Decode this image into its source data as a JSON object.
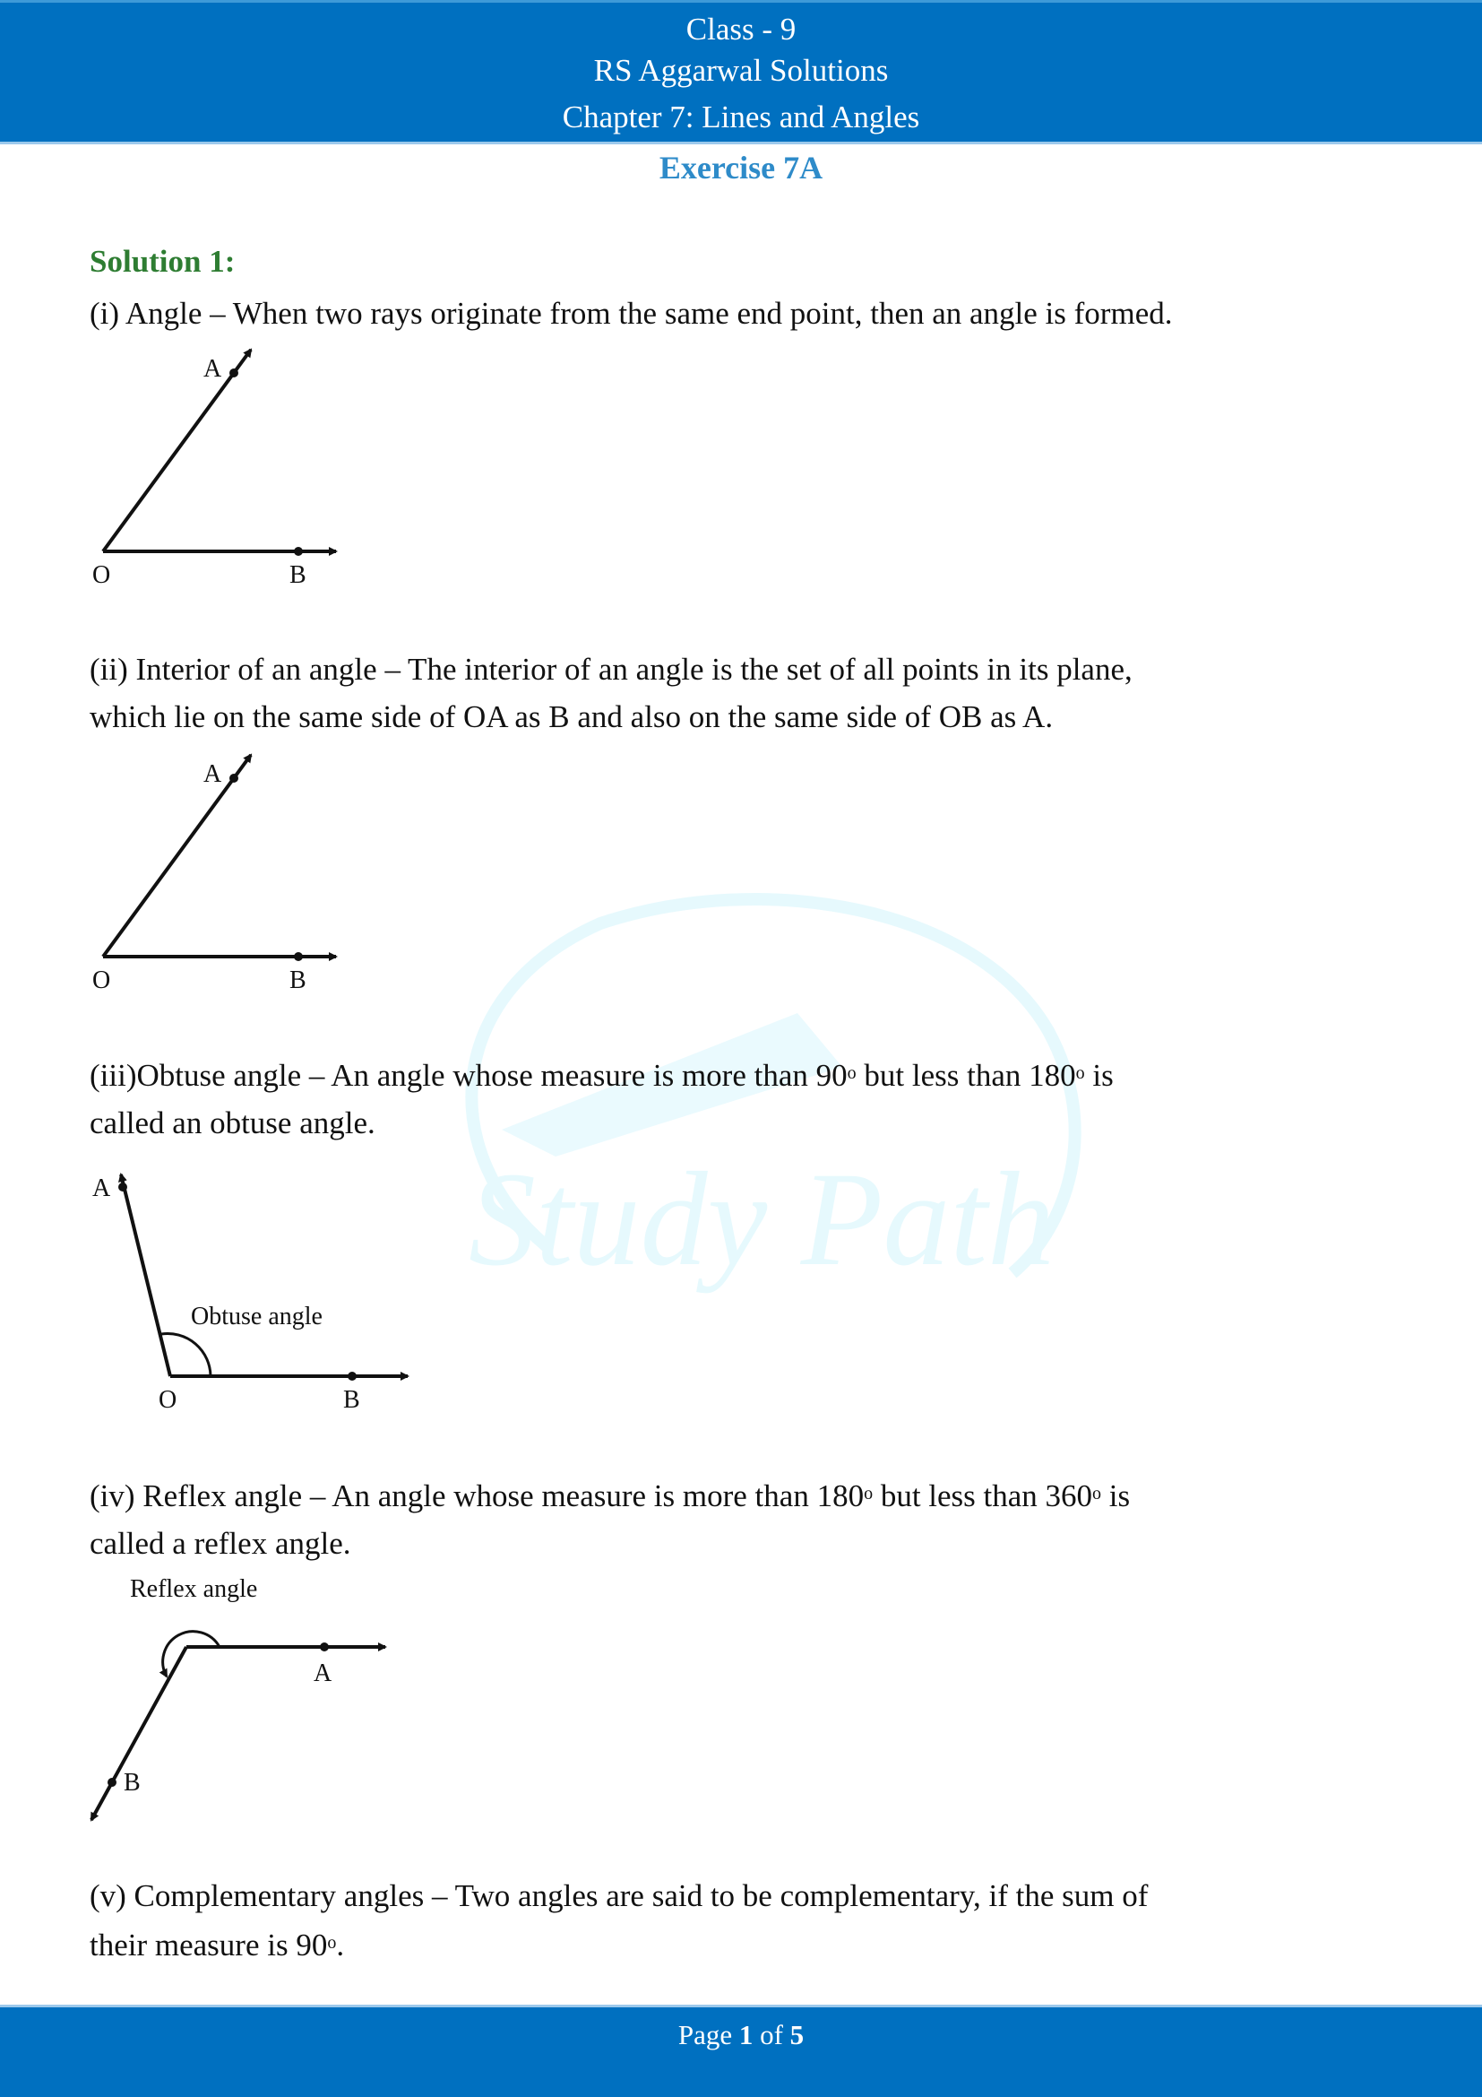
{
  "header": {
    "class_label": "Class - 9",
    "book_title": "RS Aggarwal Solutions",
    "chapter_title": "Chapter 7: Lines and Angles"
  },
  "exercise_title": "Exercise 7A",
  "solution_title": "Solution 1:",
  "sections": [
    {
      "text": "(i) Angle – When two rays originate from the same end point, then an angle is formed.",
      "figure": {
        "type": "angle",
        "labels": {
          "vertex": "O",
          "ray1_point": "A",
          "ray2_point": "B"
        }
      }
    },
    {
      "text_line1": "(ii) Interior of an angle – The interior of an angle is the set of all points in its plane,",
      "text_line2": "which lie on the same side of OA as B and also on the same side of OB as A.",
      "figure": {
        "type": "angle",
        "labels": {
          "vertex": "O",
          "ray1_point": "A",
          "ray2_point": "B"
        }
      }
    },
    {
      "text_before_90": "(iii)Obtuse angle – An angle whose measure is more than 90",
      "text_mid": " but less than 180",
      "text_after": " is",
      "text_line2": "called an obtuse angle.",
      "figure": {
        "type": "obtuse-angle",
        "caption": "Obtuse angle",
        "labels": {
          "vertex": "O",
          "ray1_point": "A",
          "ray2_point": "B"
        }
      }
    },
    {
      "text_before_180": "(iv) Reflex angle – An angle whose measure is more than 180",
      "text_mid": " but less than 360",
      "text_after": " is",
      "text_line2": "called a reflex angle.",
      "figure": {
        "type": "reflex-angle",
        "caption": "Reflex angle",
        "labels": {
          "ray1_point": "A",
          "ray2_point": "B"
        }
      }
    },
    {
      "text_line1": "(v) Complementary angles – Two angles are said to be complementary, if the sum of",
      "text_line2_before": "their measure is 90",
      "text_line2_after": "."
    }
  ],
  "degree_symbol": "o",
  "watermark": "Study Path",
  "footer": {
    "page_prefix": "Page ",
    "current_page": "1",
    "page_sep": " of ",
    "total_pages": "5"
  },
  "colors": {
    "header_bg": "#0070c0",
    "exercise_title": "#2e8bc9",
    "solution_title": "#2e7d32",
    "watermark": "#e6f9fd"
  }
}
